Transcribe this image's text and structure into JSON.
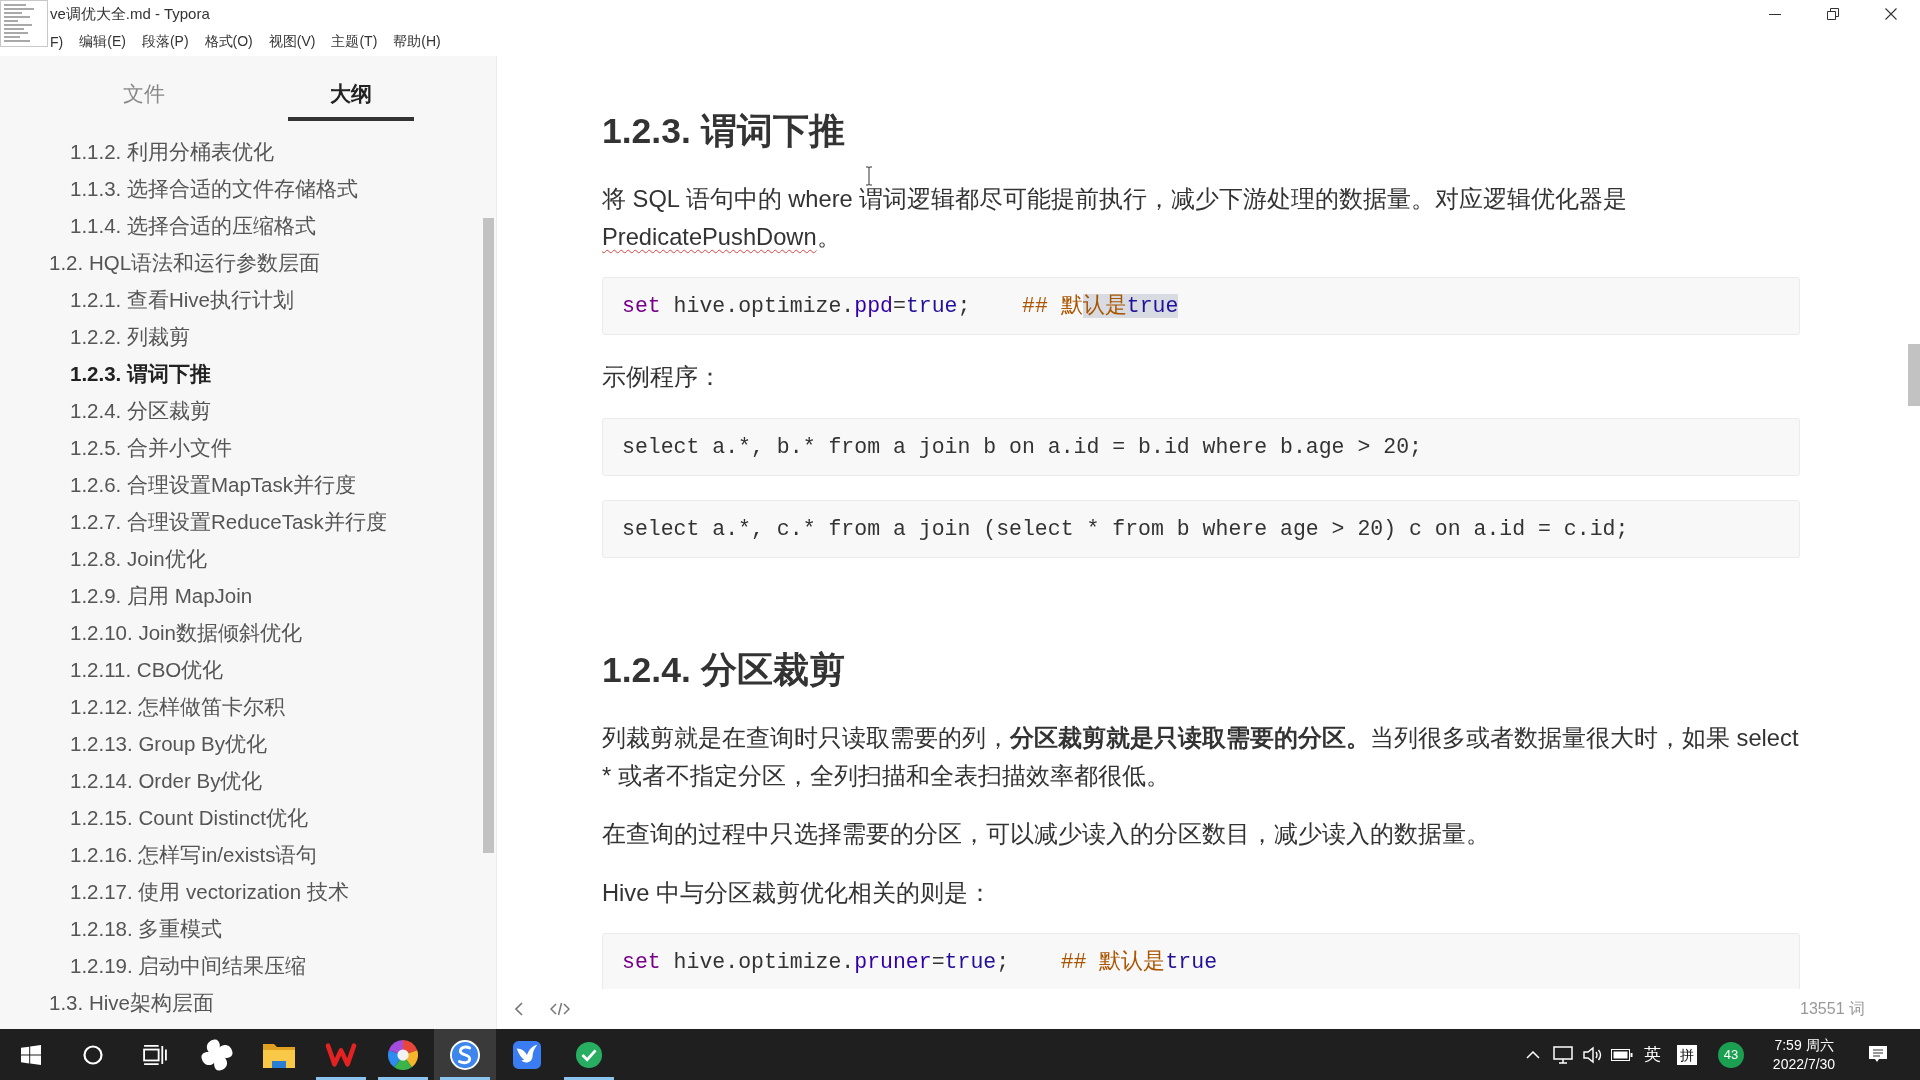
{
  "window": {
    "title": "ve调优大全.md - Typora"
  },
  "menu": [
    "F)",
    "编辑(E)",
    "段落(P)",
    "格式(O)",
    "视图(V)",
    "主题(T)",
    "帮助(H)"
  ],
  "sidebar": {
    "tabs": [
      {
        "label": "文件",
        "selected": false
      },
      {
        "label": "大纲",
        "selected": true
      }
    ],
    "outline": [
      {
        "children": [
          {
            "label": "1.1.2. 利用分桶表优化",
            "selected": false
          },
          {
            "label": "1.1.3. 选择合适的文件存储格式",
            "selected": false
          },
          {
            "label": "1.1.4. 选择合适的压缩格式",
            "selected": false
          }
        ]
      },
      {
        "label": "1.2. HQL语法和运行参数层面",
        "selected": false,
        "children": [
          {
            "label": "1.2.1. 查看Hive执行计划",
            "selected": false
          },
          {
            "label": "1.2.2. 列裁剪",
            "selected": false
          },
          {
            "label": "1.2.3. 谓词下推",
            "selected": true
          },
          {
            "label": "1.2.4. 分区裁剪",
            "selected": false
          },
          {
            "label": "1.2.5. 合并小文件",
            "selected": false
          },
          {
            "label": "1.2.6. 合理设置MapTask并行度",
            "selected": false
          },
          {
            "label": "1.2.7. 合理设置ReduceTask并行度",
            "selected": false
          },
          {
            "label": "1.2.8. Join优化",
            "selected": false
          },
          {
            "label": "1.2.9. 启用 MapJoin",
            "selected": false
          },
          {
            "label": "1.2.10. Join数据倾斜优化",
            "selected": false
          },
          {
            "label": "1.2.11. CBO优化",
            "selected": false
          },
          {
            "label": "1.2.12. 怎样做笛卡尔积",
            "selected": false
          },
          {
            "label": "1.2.13. Group By优化",
            "selected": false
          },
          {
            "label": "1.2.14. Order By优化",
            "selected": false
          },
          {
            "label": "1.2.15. Count Distinct优化",
            "selected": false
          },
          {
            "label": "1.2.16. 怎样写in/exists语句",
            "selected": false
          },
          {
            "label": "1.2.17. 使用 vectorization 技术",
            "selected": false
          },
          {
            "label": "1.2.18. 多重模式",
            "selected": false
          },
          {
            "label": "1.2.19. 启动中间结果压缩",
            "selected": false
          }
        ]
      },
      {
        "label": "1.3. Hive架构层面",
        "selected": false
      }
    ]
  },
  "document": {
    "blocks": [
      {
        "kind": "heading",
        "text": "1.2.3. 谓词下推"
      },
      {
        "kind": "paragraph",
        "segments": [
          {
            "text": "将 SQL 语句中的 where 谓词逻辑都尽可能提前执行，减少下游处理的数据量。对应逻辑优化器是",
            "bold": false,
            "misspelled": false
          },
          {
            "text": "PredicatePushDown",
            "bold": false,
            "misspelled": true
          },
          {
            "text": "。",
            "bold": false,
            "misspelled": false
          }
        ]
      },
      {
        "kind": "code",
        "lines": [
          {
            "tokens": [
              {
                "text": "set",
                "kind": "keyword",
                "selected": false
              },
              {
                "text": " hive.optimize.",
                "kind": "plain",
                "selected": false
              },
              {
                "text": "ppd",
                "kind": "builtin",
                "selected": false
              },
              {
                "text": "=",
                "kind": "plain",
                "selected": false
              },
              {
                "text": "true",
                "kind": "atom",
                "selected": false
              },
              {
                "text": ";    ",
                "kind": "plain",
                "selected": false
              },
              {
                "text": "## 默",
                "kind": "comment",
                "selected": false
              },
              {
                "text": "认是",
                "kind": "comment",
                "selected": true
              },
              {
                "text": "true",
                "kind": "atom",
                "selected": true
              }
            ]
          }
        ]
      },
      {
        "kind": "paragraph",
        "segments": [
          {
            "text": "示例程序：",
            "bold": false,
            "misspelled": false
          }
        ]
      },
      {
        "kind": "code",
        "lines": [
          {
            "tokens": [
              {
                "text": "select a.*, b.* from a join b on a.id = b.id where b.age > 20;",
                "kind": "plain",
                "selected": false
              }
            ]
          }
        ]
      },
      {
        "kind": "code",
        "lines": [
          {
            "tokens": [
              {
                "text": "select a.*, c.* from a join (select * from b where age > 20) c on a.id = c.id;",
                "kind": "plain",
                "selected": false
              }
            ]
          }
        ]
      },
      {
        "kind": "heading",
        "text": "1.2.4. 分区裁剪"
      },
      {
        "kind": "paragraph",
        "segments": [
          {
            "text": "列裁剪就是在查询时只读取需要的列，",
            "bold": false,
            "misspelled": false
          },
          {
            "text": "分区裁剪就是只读取需要的分区。",
            "bold": true,
            "misspelled": false
          },
          {
            "text": "当列很多或者数据量很大时，如果 select * 或者不指定分区，全列扫描和全表扫描效率都很低。",
            "bold": false,
            "misspelled": false
          }
        ]
      },
      {
        "kind": "paragraph",
        "segments": [
          {
            "text": "在查询的过程中只选择需要的分区，可以减少读入的分区数目，减少读入的数据量。",
            "bold": false,
            "misspelled": false
          }
        ]
      },
      {
        "kind": "paragraph",
        "segments": [
          {
            "text": "Hive 中与分区裁剪优化相关的则是：",
            "bold": false,
            "misspelled": false
          }
        ]
      },
      {
        "kind": "code",
        "lines": [
          {
            "tokens": [
              {
                "text": "set",
                "kind": "keyword",
                "selected": false
              },
              {
                "text": " hive.optimize.",
                "kind": "plain",
                "selected": false
              },
              {
                "text": "pruner",
                "kind": "builtin",
                "selected": false
              },
              {
                "text": "=",
                "kind": "plain",
                "selected": false
              },
              {
                "text": "true",
                "kind": "atom",
                "selected": false
              },
              {
                "text": ";    ",
                "kind": "plain",
                "selected": false
              },
              {
                "text": "## 默认是",
                "kind": "comment",
                "selected": false
              },
              {
                "text": "true",
                "kind": "atom",
                "selected": false
              }
            ]
          }
        ]
      }
    ]
  },
  "status_bar": {
    "word_count": "13551 词"
  },
  "taskbar": {
    "apps": [
      {
        "kind": "pinwheel",
        "running": false,
        "selected": false
      },
      {
        "kind": "folder",
        "running": false,
        "selected": false
      },
      {
        "kind": "zigzag",
        "running": true,
        "selected": false
      },
      {
        "kind": "wheel",
        "running": true,
        "selected": false
      },
      {
        "kind": "swirl",
        "running": true,
        "selected": true
      },
      {
        "kind": "bird",
        "running": false,
        "selected": false
      },
      {
        "kind": "check",
        "running": true,
        "selected": false
      }
    ],
    "tray": {
      "input_language": "英",
      "input_mode": "拼",
      "badge": "43",
      "time": "7:59 周六",
      "date": "2022/7/30"
    }
  }
}
